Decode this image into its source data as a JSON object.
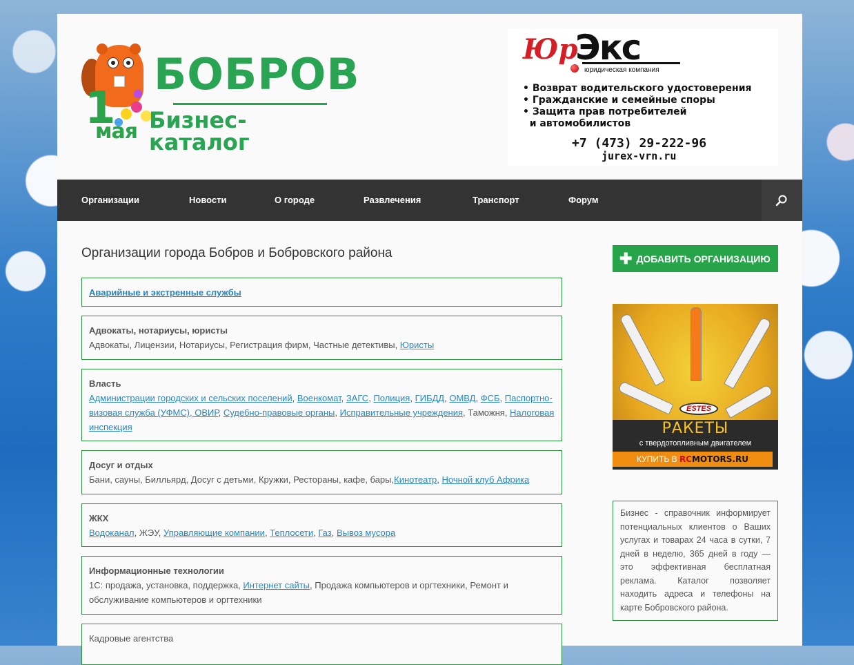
{
  "header": {
    "logo": {
      "top_word": "БОБРОВ",
      "bottom_word": "Бизнес-каталог",
      "badge_number": "1",
      "badge_word": "мая"
    },
    "ad": {
      "brand_left": "Юр",
      "brand_right": "Экс",
      "brand_sub": "юридическая компания",
      "items": [
        "• Возврат водительского удостоверения",
        "• Гражданские и семейные споры",
        "• Защита прав потребителей",
        "  и автомобилистов"
      ],
      "phone": "+7 (473) 29-222-96",
      "site": "jurex-vrn.ru"
    }
  },
  "nav": {
    "items": [
      {
        "label": "Организации"
      },
      {
        "label": "Новости"
      },
      {
        "label": "О городе"
      },
      {
        "label": "Развлечения"
      },
      {
        "label": "Транспорт"
      },
      {
        "label": "Форум"
      }
    ],
    "search_icon": "search-icon"
  },
  "main": {
    "title": "Организации города Бобров и Бобровского района",
    "categories": [
      {
        "title": "Аварийные и экстренные службы"
      },
      {
        "title": "Адвокаты, нотариусы, юристы",
        "plain": "Адвокаты, Лицензии, Нотариусы, Регистрация фирм, Частные детективы, ",
        "link": "Юристы"
      },
      {
        "title": "Власть",
        "links": [
          "Администрации городских и сельских поселений",
          "Военкомат",
          "ЗАГС",
          "Полиция",
          "ГИБДД",
          "ОМВД",
          "ФСБ",
          "Паспортно-визовая служба (УФМС), ОВИР",
          "Судебно-правовые органы",
          "Исправительные учреждения"
        ],
        "plain1": "Таможня",
        "link_last": "Налоговая инспекция"
      },
      {
        "title": "Досуг и отдых",
        "plain": "Бани, сауны, Билльярд, Досуг с детьми, Кружки, Рестораны, кафе, бары,",
        "links": [
          "Кинотеатр",
          "Ночной клуб Африка"
        ]
      },
      {
        "title": "ЖКХ",
        "link1": "Водоканал",
        "plain": "ЖЭУ",
        "links": [
          "Управляющие компании",
          "Теплосети",
          "Газ",
          "Вывоз мусора"
        ]
      },
      {
        "title": "Информационные технологии",
        "plain1": "1С: продажа, установка, поддержка, ",
        "link": "Интернет сайты",
        "plain2": ", Продажа компьютеров и оргтехники, Ремонт и обслуживание компьютеров и оргтехники"
      },
      {
        "title": "Кадровые агентства"
      }
    ]
  },
  "sidebar": {
    "add_button": "ДОБАВИТЬ ОРГАНИЗАЦИЮ",
    "rocket_ad": {
      "brand": "ESTES",
      "title": "РАКЕТЫ",
      "subtitle": "с твердотопливным двигателем",
      "buy_prefix": "КУПИТЬ В",
      "buy_rc": "RC",
      "buy_rest": "MOTORS.RU"
    },
    "info_text": "Бизнес - справочник информирует потенциальных клиентов о Ваших услугах и товарах 24 часа в сутки, 7 дней в неделю, 365 дней в году — это эффективная бесплатная реклама. Каталог позволяет находить адреса и телефоны на карте Бобровского района."
  },
  "colors": {
    "brand_green": "#29a453",
    "nav_bg": "#333333",
    "link_blue": "#2a86c2",
    "border_green": "#2a8f3a"
  }
}
